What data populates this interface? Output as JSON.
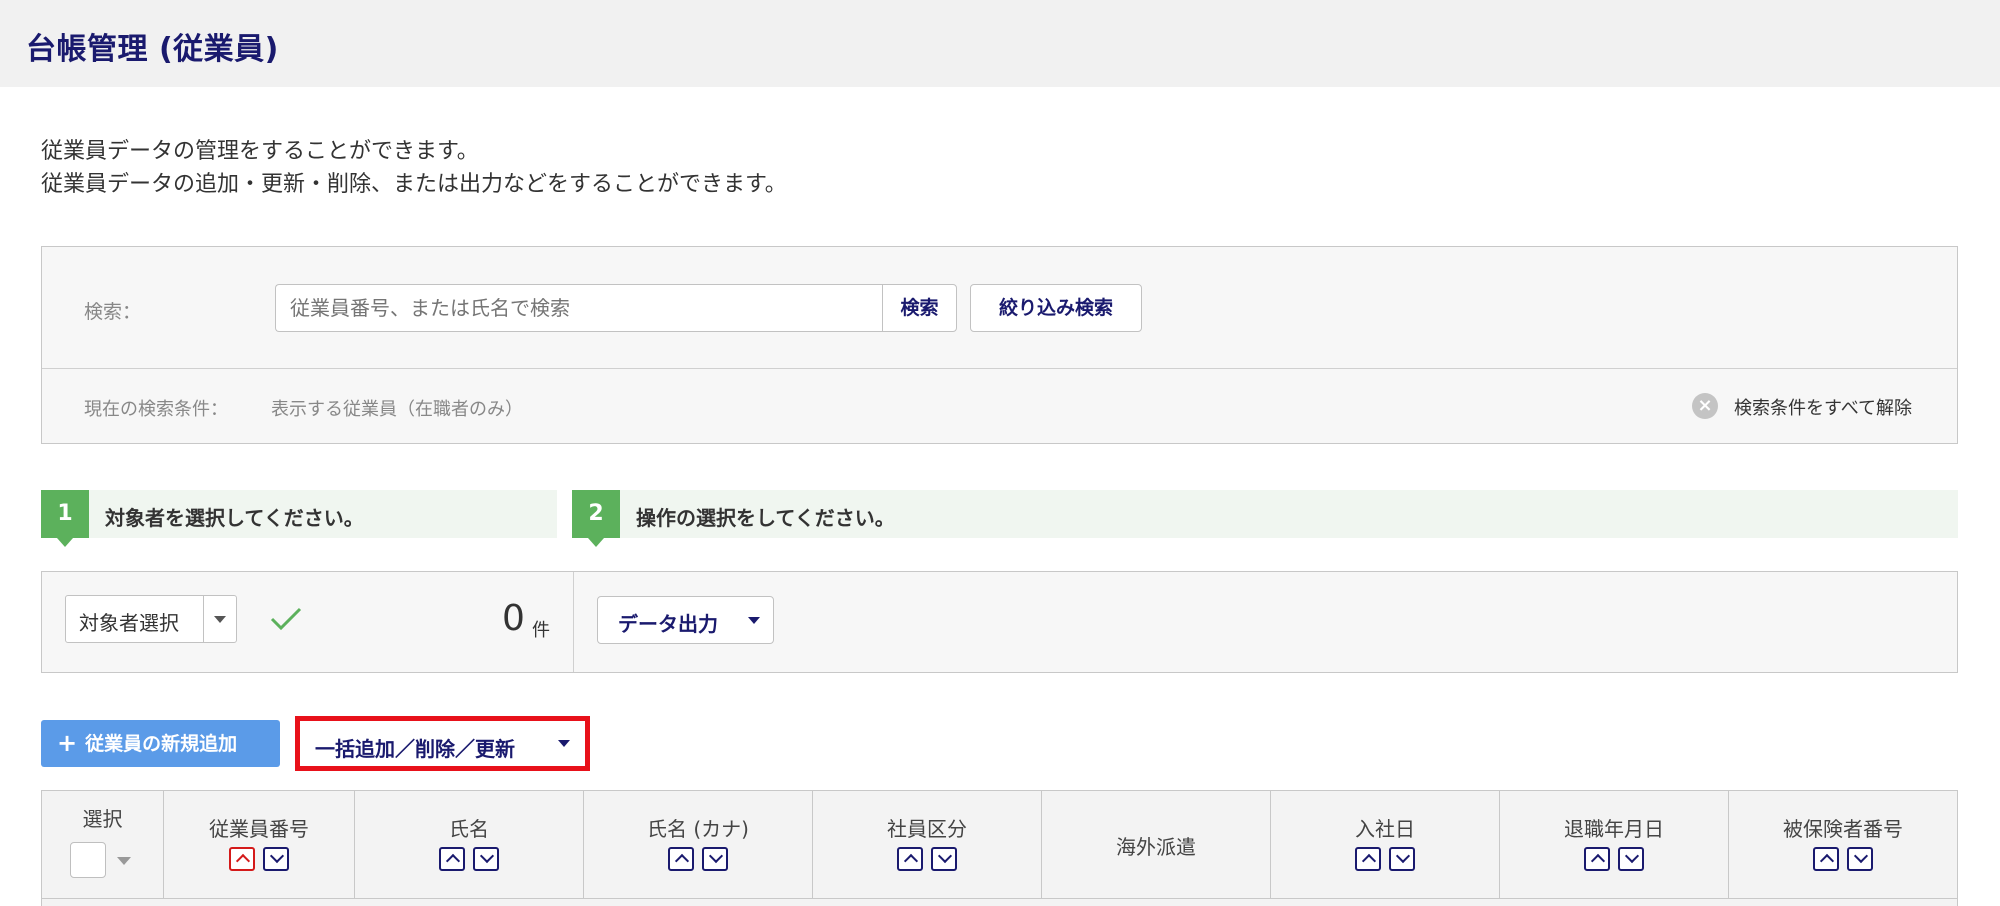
{
  "header": {
    "title": "台帳管理 (従業員)"
  },
  "description": [
    "従業員データの管理をすることができます。",
    "従業員データの追加・更新・削除、または出力などをすることができます。"
  ],
  "search": {
    "label": "検索：",
    "placeholder": "従業員番号、または氏名で検索",
    "value": "",
    "search_button": "検索",
    "refine_button": "絞り込み検索",
    "conditions_label": "現在の検索条件：",
    "conditions_value": "表示する従業員（在職者のみ）",
    "clear_all": "検索条件をすべて解除"
  },
  "steps": [
    {
      "number": "1",
      "text": "対象者を選択してください。"
    },
    {
      "number": "2",
      "text": "操作の選択をしてください。"
    }
  ],
  "selection": {
    "target_select": "対象者選択",
    "count": "0",
    "count_unit": "件",
    "data_output": "データ出力"
  },
  "actions": {
    "add_employee": "従業員の新規追加",
    "bulk_edit": "一括追加／削除／更新"
  },
  "table": {
    "columns": [
      {
        "label": "選択",
        "sortable": false
      },
      {
        "label": "従業員番号",
        "sortable": true,
        "active_sort": "asc"
      },
      {
        "label": "氏名",
        "sortable": true
      },
      {
        "label": "氏名 (カナ)",
        "sortable": true
      },
      {
        "label": "社員区分",
        "sortable": true
      },
      {
        "label": "海外派遣",
        "sortable": false
      },
      {
        "label": "入社日",
        "sortable": true
      },
      {
        "label": "退職年月日",
        "sortable": true
      },
      {
        "label": "被保険者番号",
        "sortable": true
      }
    ]
  },
  "colors": {
    "title": "#1a1a6e",
    "step_badge": "#5cb15c",
    "primary_button": "#5b9be8",
    "highlight_border": "#e8111a"
  }
}
